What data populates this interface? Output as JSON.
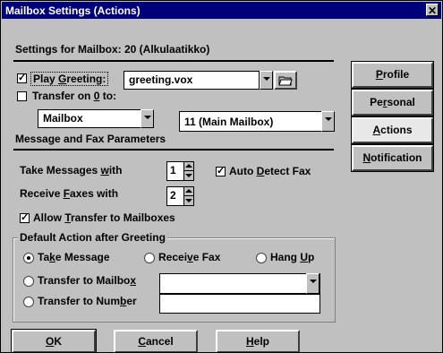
{
  "window": {
    "title": "Mailbox Settings (Actions)",
    "close_glyph": "✕"
  },
  "header": {
    "settings_for": "Settings for Mailbox: 20  (Alkulaatikko)"
  },
  "greeting": {
    "play_checked": true,
    "play_label_pre": "Play ",
    "play_label_key": "G",
    "play_label_post": "reeting:",
    "file_value": "greeting.vox"
  },
  "transfer": {
    "checked": false,
    "label_pre": "Transfer on ",
    "label_key": "0",
    "label_post": " to:",
    "type_value": "Mailbox",
    "target_value": "11  (Main Mailbox)"
  },
  "params": {
    "heading": "Message and Fax Parameters",
    "take_pre": "Take Messages ",
    "take_key": "w",
    "take_post": "ith",
    "take_value": "1",
    "fax_label": "Auto Detect Fax",
    "fax_checked": true,
    "fax_key": "D",
    "fax_pre": "Auto ",
    "fax_post": "etect Fax",
    "recv_pre": "Receive ",
    "recv_key": "F",
    "recv_post": "axes with",
    "recv_value": "2",
    "allow_checked": true,
    "allow_pre": "Allow ",
    "allow_key": "T",
    "allow_post": "ransfer to Mailboxes"
  },
  "default_action": {
    "group_label": "Default Action after Greeting",
    "take_pre": "Ta",
    "take_key": "k",
    "take_post": "e Message",
    "receive_pre": "Recei",
    "receive_key": "v",
    "receive_post": "e Fax",
    "hang_pre": "Hang ",
    "hang_key": "U",
    "hang_post": "p",
    "tmb_pre": "Transfer to Mailbo",
    "tmb_key": "x",
    "tmb_post": "",
    "tnum_pre": "Transfer to Num",
    "tnum_key": "b",
    "tnum_post": "er",
    "mailbox_value": "",
    "number_value": "",
    "selected": "take_message"
  },
  "sidebar": {
    "profile_pre": "",
    "profile_key": "P",
    "profile_post": "rofile",
    "personal_pre": "Pe",
    "personal_key": "r",
    "personal_post": "sonal",
    "actions_pre": "",
    "actions_key": "A",
    "actions_post": "ctions",
    "notif_pre": "",
    "notif_key": "N",
    "notif_post": "otification",
    "active": "actions"
  },
  "footer": {
    "ok_pre": "",
    "ok_key": "O",
    "ok_post": "K",
    "cancel_pre": "",
    "cancel_key": "C",
    "cancel_post": "ancel",
    "help_pre": "",
    "help_key": "H",
    "help_post": "elp"
  },
  "icons": {
    "folder": "folder-icon"
  },
  "colors": {
    "titlebar": "#00007b",
    "face": "#c0c0c0"
  }
}
